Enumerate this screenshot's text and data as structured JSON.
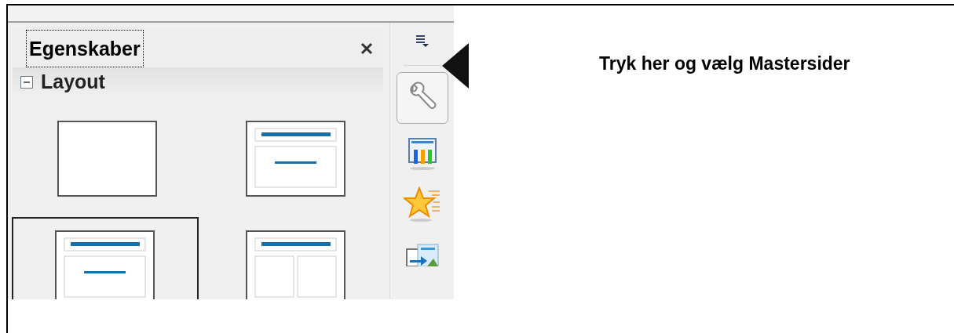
{
  "panel": {
    "title": "Egenskaber"
  },
  "section": {
    "title": "Layout",
    "expanded": true
  },
  "layouts": [
    {
      "kind": "blank",
      "selected": false
    },
    {
      "kind": "title-content",
      "selected": false
    },
    {
      "kind": "title-content",
      "selected": true
    },
    {
      "kind": "title-two-columns",
      "selected": false
    }
  ],
  "deck": [
    {
      "kind": "properties",
      "selected": true
    },
    {
      "kind": "master-pages",
      "selected": false
    },
    {
      "kind": "animation",
      "selected": false
    },
    {
      "kind": "transition",
      "selected": false
    }
  ],
  "annotation": {
    "text": "Tryk her og vælg Mastersider"
  }
}
